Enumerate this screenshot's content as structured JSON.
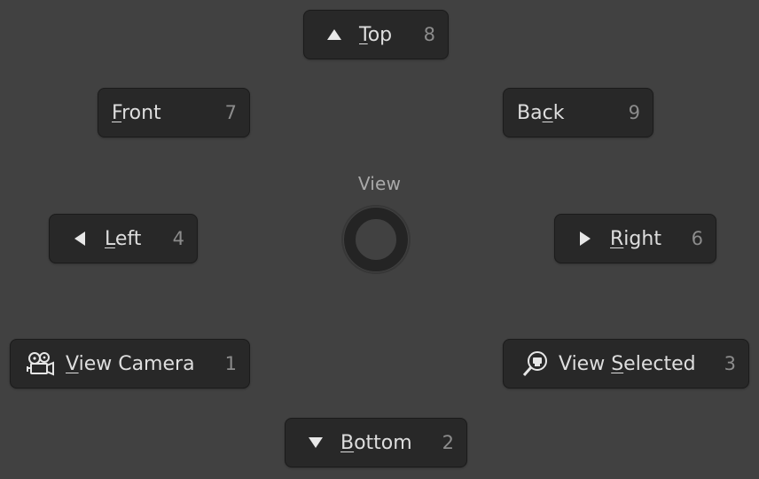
{
  "pie_menu": {
    "title": "View",
    "items": {
      "top": {
        "label_pre": "",
        "label_key": "T",
        "label_post": "op",
        "hotkey": "8",
        "icon": "triangle-up-icon"
      },
      "front": {
        "label_pre": "",
        "label_key": "F",
        "label_post": "ront",
        "hotkey": "7",
        "icon": ""
      },
      "back": {
        "label_pre": "Ba",
        "label_key": "c",
        "label_post": "k",
        "hotkey": "9",
        "icon": ""
      },
      "left": {
        "label_pre": "",
        "label_key": "L",
        "label_post": "eft",
        "hotkey": "4",
        "icon": "triangle-left-icon"
      },
      "right": {
        "label_pre": "",
        "label_key": "R",
        "label_post": "ight",
        "hotkey": "6",
        "icon": "triangle-right-icon"
      },
      "view_camera": {
        "label_pre": "",
        "label_key": "V",
        "label_post": "iew Camera",
        "hotkey": "1",
        "icon": "camera-icon"
      },
      "view_selected": {
        "label_pre": "View ",
        "label_key": "S",
        "label_post": "elected",
        "hotkey": "3",
        "icon": "zoom-selected-icon"
      },
      "bottom": {
        "label_pre": "",
        "label_key": "B",
        "label_post": "ottom",
        "hotkey": "2",
        "icon": "triangle-down-icon"
      }
    }
  }
}
